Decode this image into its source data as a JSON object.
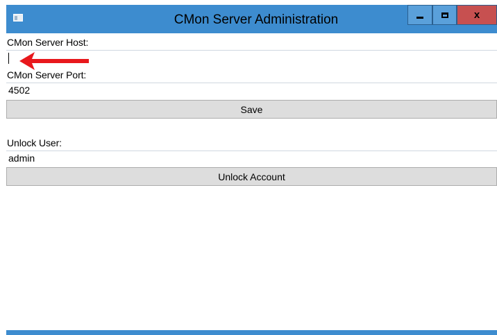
{
  "window": {
    "title": "CMon Server Administration",
    "close_glyph": "x",
    "icons": [
      "app-icon",
      "minimize-icon",
      "maximize-icon",
      "close-icon"
    ]
  },
  "server": {
    "host_label": "CMon Server Host:",
    "host_value": "",
    "port_label": "CMon Server Port:",
    "port_value": "4502",
    "save_label": "Save"
  },
  "unlock": {
    "user_label": "Unlock User:",
    "user_value": "admin",
    "button_label": "Unlock Account"
  },
  "annotation": {
    "arrow_color": "#e8181c"
  },
  "colors": {
    "titlebar": "#3d8ccf",
    "button_face": "#dddddd",
    "close_button": "#c75050"
  }
}
